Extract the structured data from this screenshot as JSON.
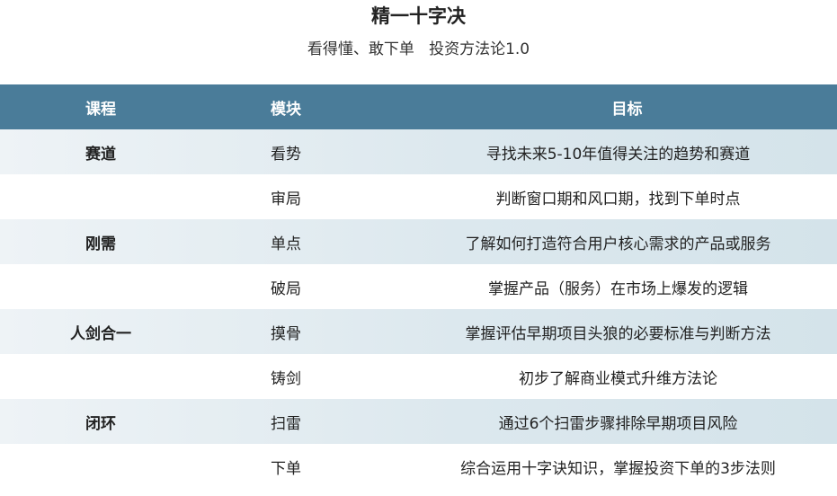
{
  "document": {
    "title": "精一十字决",
    "subtitle": "看得懂、敢下单   投资方法论1.0"
  },
  "table": {
    "headers": {
      "course": "课程",
      "module": "模块",
      "goal": "目标"
    },
    "rows": [
      {
        "course": "赛道",
        "module": "看势",
        "goal": "寻找未来5-10年值得关注的趋势和赛道"
      },
      {
        "course": "",
        "module": "审局",
        "goal": "判断窗口期和风口期，找到下单时点"
      },
      {
        "course": "刚需",
        "module": "单点",
        "goal": "了解如何打造符合用户核心需求的产品或服务"
      },
      {
        "course": "",
        "module": "破局",
        "goal": "掌握产品（服务）在市场上爆发的逻辑"
      },
      {
        "course": "人剑合一",
        "module": "摸骨",
        "goal": "掌握评估早期项目头狼的必要标准与判断方法"
      },
      {
        "course": "",
        "module": "铸剑",
        "goal": "初步了解商业模式升维方法论"
      },
      {
        "course": "闭环",
        "module": "扫雷",
        "goal": "通过6个扫雷步骤排除早期项目风险"
      },
      {
        "course": "",
        "module": "下单",
        "goal": "综合运用十字诀知识，掌握投资下单的3步法则"
      }
    ]
  },
  "colors": {
    "header_bg": "#4a7c99",
    "header_text": "#ffffff",
    "shaded_row": "#dce8ee"
  }
}
